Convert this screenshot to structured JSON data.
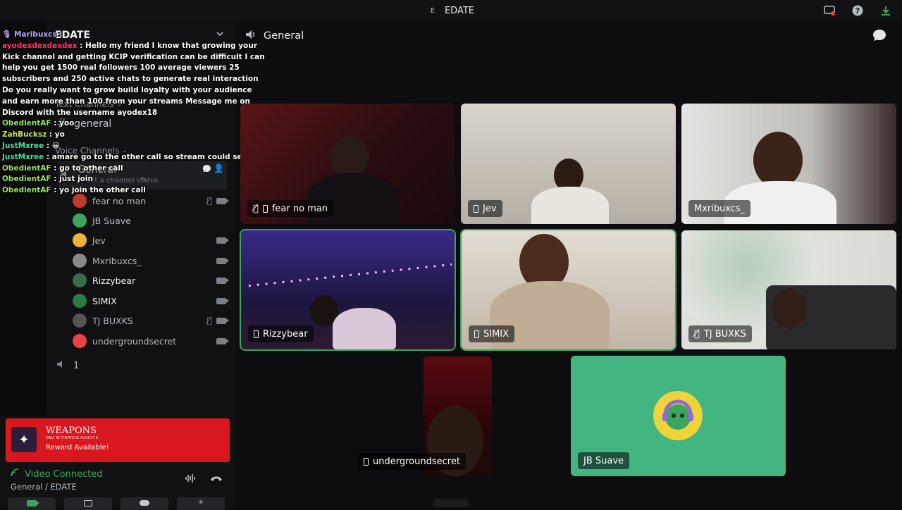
{
  "window": {
    "badge": "E",
    "title": "EDATE"
  },
  "server": {
    "name": "EDATE"
  },
  "sidebar": {
    "text_category": "Text Channels",
    "text_channel": "general",
    "voice_category": "Voice Channels",
    "voice_channel": "General",
    "channel_status_placeholder": "Set a channel status",
    "stage_count": "1",
    "members": [
      {
        "name": "fear no man",
        "avatar_color": "#c0392b"
      },
      {
        "name": "JB Suave",
        "avatar_color": "#3ba55d"
      },
      {
        "name": "Jev",
        "avatar_color": "#f0b232"
      },
      {
        "name": "Mxribuxcs_",
        "avatar_color": "#888888"
      },
      {
        "name": "Rizzybear",
        "avatar_color": "#3a6b4a"
      },
      {
        "name": "SIMIX",
        "avatar_color": "#2d7a45"
      },
      {
        "name": "TJ BUXKS",
        "avatar_color": "#555555"
      },
      {
        "name": "undergroundsecret",
        "avatar_color": "#ed4245"
      }
    ]
  },
  "chat": [
    {
      "user": "Maribuxcs",
      "msg": ":",
      "color": "#b9a3ff"
    },
    {
      "user": "ayodexdexdexdex",
      "msg": ": Hello my friend I know that growing your Kick channel and getting KCIP verification can be difficult I can help you get 1500 real followers 100 average viewers 25 subscribers and 250 active chats to generate real interaction Do you really want to grow build loyalty with your audience and earn more than 100 from your streams Message me on Discord with the username ayodex18",
      "color": "#ff3b6b"
    },
    {
      "user": "ObedientAF",
      "msg": ": yoo",
      "color": "#9be36a"
    },
    {
      "user": "ZahBucksz",
      "msg": ": yo",
      "color": "#c8e36a"
    },
    {
      "user": "JustMxree",
      "msg": ": 😀",
      "color": "#4de3a0"
    },
    {
      "user": "JustMxree",
      "msg": ": amare go to the other call so stream could see",
      "color": "#4de3a0"
    },
    {
      "user": "ObedientAF",
      "msg": ": go to other call",
      "color": "#9be36a"
    },
    {
      "user": "ObedientAF",
      "msg": ": just join",
      "color": "#9be36a"
    },
    {
      "user": "ObedientAF",
      "msg": ": yo join the other call",
      "color": "#9be36a"
    }
  ],
  "promo": {
    "logo_icon": "star-icon",
    "title": "WEAPONS",
    "subtitle": "ONLY IN THEATERS AUGUST 8",
    "text": "Reward Available!",
    "color": "#d9171f"
  },
  "voice_status": {
    "status": "Video Connected",
    "location": "General / EDATE",
    "color": "#3ba55d"
  },
  "main": {
    "channel_title": "General"
  },
  "tiles": [
    {
      "name": "fear no man",
      "muted": true,
      "bg": "#3a1518"
    },
    {
      "name": "Jev",
      "muted": false,
      "bg": "#bdb9b2"
    },
    {
      "name": "Mxribuxcs_",
      "muted": false,
      "bg": "#c9c9c7"
    },
    {
      "name": "Rizzybear",
      "muted": false,
      "bg": "#2a1a5a"
    },
    {
      "name": "SIMIX",
      "muted": false,
      "bg": "#c9c2b6"
    },
    {
      "name": "TJ BUXKS",
      "muted": true,
      "bg": "#cfd3cb"
    },
    {
      "name": "undergroundsecret",
      "muted": false,
      "bg": "#3a0a10"
    },
    {
      "name": "JB Suave",
      "muted": false,
      "bg": "#43b581"
    }
  ]
}
